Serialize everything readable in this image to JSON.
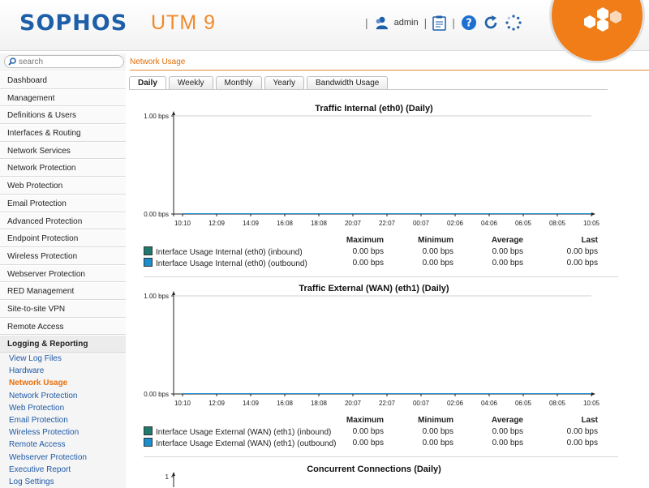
{
  "header": {
    "logo": "SOPHOS",
    "product": "UTM 9",
    "user": "admin",
    "colors": {
      "brand_blue": "#1d5fa8",
      "orange": "#f07d18"
    },
    "icons": [
      "user-icon",
      "clipboard-icon",
      "help-icon",
      "reload-icon",
      "spinner-icon"
    ]
  },
  "sidebar": {
    "search_placeholder": "search",
    "items": [
      "Dashboard",
      "Management",
      "Definitions & Users",
      "Interfaces & Routing",
      "Network Services",
      "Network Protection",
      "Web Protection",
      "Email Protection",
      "Advanced Protection",
      "Endpoint Protection",
      "Wireless Protection",
      "Webserver Protection",
      "RED Management",
      "Site-to-site VPN",
      "Remote Access",
      "Logging & Reporting"
    ],
    "subitems": [
      "View Log Files",
      "Hardware",
      "Network Usage",
      "Network Protection",
      "Web Protection",
      "Email Protection",
      "Wireless Protection",
      "Remote Access",
      "Webserver Protection",
      "Executive Report",
      "Log Settings"
    ],
    "active_sub": "Network Usage"
  },
  "main": {
    "breadcrumb": "Network Usage",
    "tabs": [
      "Daily",
      "Weekly",
      "Monthly",
      "Yearly",
      "Bandwidth Usage"
    ],
    "selected_tab": "Daily"
  },
  "legend_headers": [
    "Maximum",
    "Minimum",
    "Average",
    "Last"
  ],
  "chart_data": [
    {
      "type": "line",
      "title": "Traffic Internal (eth0) (Daily)",
      "y_ticks": [
        "1.00 bps",
        "0.00 bps"
      ],
      "x": [
        "10:10",
        "12:09",
        "14:09",
        "16:08",
        "18:08",
        "20:07",
        "22:07",
        "00:07",
        "02:06",
        "04:06",
        "06:05",
        "08:05",
        "10:05"
      ],
      "series": [
        {
          "name": "Interface Usage Internal (eth0) (inbound)",
          "color": "#1e7a6e",
          "values": [
            0,
            0,
            0,
            0,
            0,
            0,
            0,
            0,
            0,
            0,
            0,
            0,
            0
          ],
          "stats": [
            "0.00 bps",
            "0.00 bps",
            "0.00 bps",
            "0.00 bps"
          ]
        },
        {
          "name": "Interface Usage Internal (eth0) (outbound)",
          "color": "#1a8fd0",
          "values": [
            0,
            0,
            0,
            0,
            0,
            0,
            0,
            0,
            0,
            0,
            0,
            0,
            0
          ],
          "stats": [
            "0.00 bps",
            "0.00 bps",
            "0.00 bps",
            "0.00 bps"
          ]
        }
      ]
    },
    {
      "type": "line",
      "title": "Traffic External (WAN) (eth1) (Daily)",
      "y_ticks": [
        "1.00 bps",
        "0.00 bps"
      ],
      "x": [
        "10:10",
        "12:09",
        "14:09",
        "16:08",
        "18:08",
        "20:07",
        "22:07",
        "00:07",
        "02:06",
        "04:06",
        "06:05",
        "08:05",
        "10:05"
      ],
      "series": [
        {
          "name": "Interface Usage External (WAN) (eth1) (inbound)",
          "color": "#1e7a6e",
          "values": [
            0,
            0,
            0,
            0,
            0,
            0,
            0,
            0,
            0,
            0,
            0,
            0,
            0
          ],
          "stats": [
            "0.00 bps",
            "0.00 bps",
            "0.00 bps",
            "0.00 bps"
          ]
        },
        {
          "name": "Interface Usage External (WAN) (eth1) (outbound)",
          "color": "#1a8fd0",
          "values": [
            0,
            0,
            0,
            0,
            0,
            0,
            0,
            0,
            0,
            0,
            0,
            0,
            0
          ],
          "stats": [
            "0.00 bps",
            "0.00 bps",
            "0.00 bps",
            "0.00 bps"
          ]
        }
      ]
    },
    {
      "type": "line",
      "title": "Concurrent Connections (Daily)",
      "y_ticks": [
        "1"
      ]
    }
  ]
}
